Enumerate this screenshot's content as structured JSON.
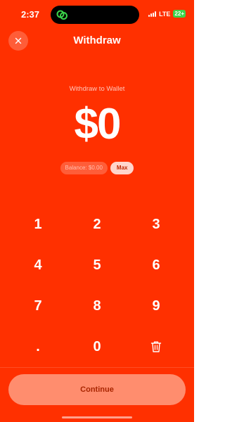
{
  "status_bar": {
    "time": "2:37",
    "network": "LTE",
    "battery": "22+",
    "island_icon": "link-rings-icon"
  },
  "header": {
    "title": "Withdraw",
    "close_icon": "close-icon"
  },
  "subtitle": "Withdraw to Wallet",
  "amount": "$0",
  "balance": {
    "label": "Balance: $0.00",
    "max_label": "Max"
  },
  "keypad": {
    "keys": [
      "1",
      "2",
      "3",
      "4",
      "5",
      "6",
      "7",
      "8",
      "9",
      ".",
      "0"
    ],
    "delete_icon": "trash-icon"
  },
  "continue_label": "Continue",
  "colors": {
    "background": "#FF3000",
    "continue_bg": "#FF8D6E",
    "continue_text": "#A92500",
    "island_icon": "#3CD44A"
  }
}
